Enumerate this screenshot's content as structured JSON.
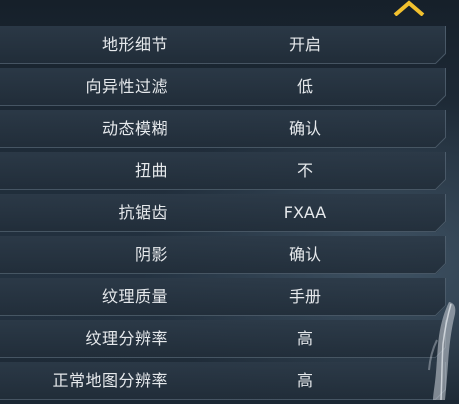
{
  "settings": [
    {
      "label": "地形细节",
      "value": "开启"
    },
    {
      "label": "向异性过滤",
      "value": "低"
    },
    {
      "label": "动态模糊",
      "value": "确认"
    },
    {
      "label": "扭曲",
      "value": "不"
    },
    {
      "label": "抗锯齿",
      "value": "FXAA"
    },
    {
      "label": "阴影",
      "value": "确认"
    },
    {
      "label": "纹理质量",
      "value": "手册"
    },
    {
      "label": "纹理分辨率",
      "value": "高"
    },
    {
      "label": "正常地图分辨率",
      "value": "高"
    }
  ],
  "icons": {
    "scroll_up": "chevron-up-icon"
  },
  "colors": {
    "accent": "#f2c12e",
    "row_background": "#2a3846",
    "text": "#e6e9ec"
  }
}
